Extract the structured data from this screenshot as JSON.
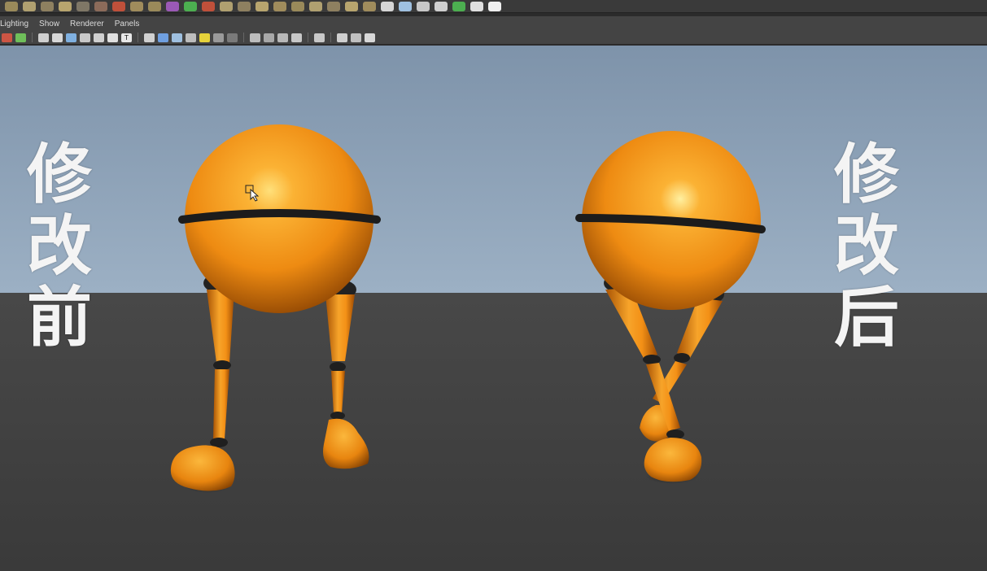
{
  "shelf": {
    "icons": [
      {
        "name": "shelf-tool-1-icon",
        "color": "#9a8a5a"
      },
      {
        "name": "shelf-tool-2-icon",
        "color": "#b0a070"
      },
      {
        "name": "shelf-tool-3-icon",
        "color": "#8e8060"
      },
      {
        "name": "shelf-tool-4-icon",
        "color": "#b8a56e"
      },
      {
        "name": "shelf-tool-5-icon",
        "color": "#7f7766"
      },
      {
        "name": "shelf-tool-6-icon",
        "color": "#8c6b5a"
      },
      {
        "name": "shelf-tool-7-icon",
        "color": "#c0503a"
      },
      {
        "name": "shelf-tool-8-icon",
        "color": "#a08c5c"
      },
      {
        "name": "shelf-tool-9-icon",
        "color": "#9a8a5a"
      },
      {
        "name": "shelf-cube-icon",
        "color": "#9b59b6"
      },
      {
        "name": "shelf-select-icon",
        "color": "#4caf50"
      },
      {
        "name": "shelf-tool-12-icon",
        "color": "#c0503a"
      },
      {
        "name": "shelf-tool-13-icon",
        "color": "#b0a070"
      },
      {
        "name": "shelf-tool-14-icon",
        "color": "#8e8060"
      },
      {
        "name": "shelf-tool-15-icon",
        "color": "#b8a56e"
      },
      {
        "name": "shelf-tool-16-icon",
        "color": "#a08c5c"
      },
      {
        "name": "shelf-tool-17-icon",
        "color": "#9a8a5a"
      },
      {
        "name": "shelf-tool-18-icon",
        "color": "#b0a070"
      },
      {
        "name": "shelf-tool-19-icon",
        "color": "#8e8060"
      },
      {
        "name": "shelf-tool-20-icon",
        "color": "#b8a56e"
      },
      {
        "name": "shelf-tool-21-icon",
        "color": "#a08c5c"
      },
      {
        "name": "shelf-tool-22-icon",
        "color": "#d6d6d6"
      },
      {
        "name": "shelf-tool-23-icon",
        "color": "#9fc0e0"
      },
      {
        "name": "shelf-tool-24-icon",
        "color": "#c8c8c8"
      },
      {
        "name": "shelf-tool-25-icon",
        "color": "#cfcfcf"
      },
      {
        "name": "shelf-tool-26-icon",
        "color": "#4caf50"
      },
      {
        "name": "shelf-tool-27-icon",
        "color": "#e0e0e0"
      },
      {
        "name": "shelf-tool-28-icon",
        "color": "#f0f0f0"
      }
    ]
  },
  "menu": {
    "items": [
      "Lighting",
      "Show",
      "Renderer",
      "Panels"
    ]
  },
  "toolbar": {
    "icons": [
      {
        "name": "camera-attributes-icon",
        "color": "#cc5544",
        "glyph": ""
      },
      {
        "name": "select-camera-icon",
        "color": "#6fbf5a",
        "glyph": ""
      },
      {
        "name": "sep",
        "color": "",
        "glyph": ""
      },
      {
        "name": "wireframe-icon",
        "color": "#cfcfcf",
        "glyph": ""
      },
      {
        "name": "grid-icon",
        "color": "#d8d8d8",
        "glyph": ""
      },
      {
        "name": "film-gate-icon",
        "color": "#7fb0e0",
        "glyph": ""
      },
      {
        "name": "resolution-gate-icon",
        "color": "#c8c8c8",
        "glyph": ""
      },
      {
        "name": "gate-mask-icon",
        "color": "#d0d0d0",
        "glyph": ""
      },
      {
        "name": "field-chart-icon",
        "color": "#e0e0e0",
        "glyph": ""
      },
      {
        "name": "safe-title-icon",
        "color": "#e8e8e8",
        "glyph": "T"
      },
      {
        "name": "sep",
        "color": "",
        "glyph": ""
      },
      {
        "name": "wireframe-shade-icon",
        "color": "#d0d0d0",
        "glyph": ""
      },
      {
        "name": "smooth-shade-icon",
        "color": "#6f9fe0",
        "glyph": ""
      },
      {
        "name": "wireframe-on-shaded-icon",
        "color": "#9fc0e0",
        "glyph": ""
      },
      {
        "name": "textured-icon",
        "color": "#bdbdbd",
        "glyph": ""
      },
      {
        "name": "use-all-lights-icon",
        "color": "#e6d23a",
        "glyph": ""
      },
      {
        "name": "shadows-icon",
        "color": "#9a9a9a",
        "glyph": ""
      },
      {
        "name": "high-quality-icon",
        "color": "#7a7a7a",
        "glyph": ""
      },
      {
        "name": "sep",
        "color": "",
        "glyph": ""
      },
      {
        "name": "isolate-select-icon",
        "color": "#bdbdbd",
        "glyph": ""
      },
      {
        "name": "xray-icon",
        "color": "#a8a8a8",
        "glyph": ""
      },
      {
        "name": "xray-joints-icon",
        "color": "#b8b8b8",
        "glyph": ""
      },
      {
        "name": "backface-culling-icon",
        "color": "#c8c8c8",
        "glyph": ""
      },
      {
        "name": "sep",
        "color": "",
        "glyph": ""
      },
      {
        "name": "select-tool-icon",
        "color": "#c8c8c8",
        "glyph": ""
      },
      {
        "name": "sep",
        "color": "",
        "glyph": ""
      },
      {
        "name": "view-cube-icon",
        "color": "#d0d0d0",
        "glyph": ""
      },
      {
        "name": "frame-all-icon",
        "color": "#c0c0c0",
        "glyph": ""
      },
      {
        "name": "share-icon",
        "color": "#d8d8d8",
        "glyph": ""
      }
    ]
  },
  "viewport": {
    "captions": {
      "before": "修改前",
      "after": "修改后"
    },
    "colors": {
      "sky_top": "#7e93aa",
      "sky_bottom": "#9cb0c4",
      "ground": "#3c3c3c",
      "body": "#f49a1c",
      "body_shadow": "#b85e06",
      "band": "#1c1c1c"
    }
  }
}
